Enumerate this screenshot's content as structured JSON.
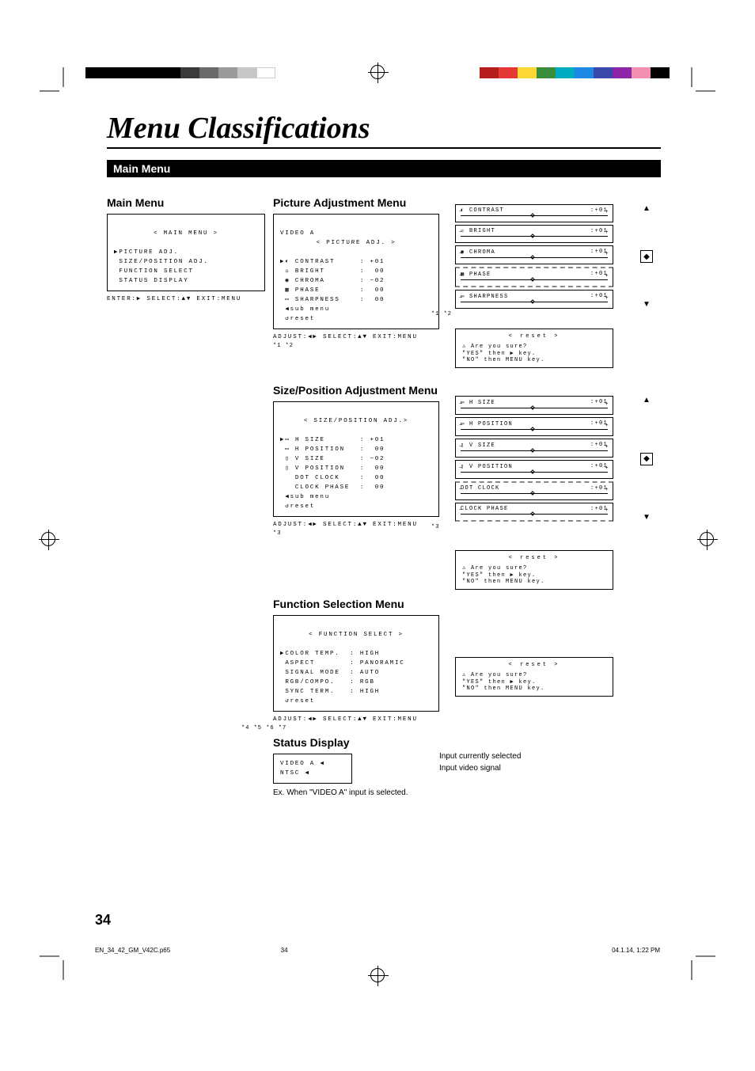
{
  "title": "Menu Classifications",
  "section": "Main Menu",
  "page_number": "34",
  "footer": {
    "file": "EN_34_42_GM_V42C.p65",
    "page": "34",
    "date": "04.1.14, 1:22 PM"
  },
  "color_bars_left": [
    "#000",
    "#000",
    "#000",
    "#000",
    "#000",
    "#3a3a3a",
    "#6a6a6a",
    "#9a9a9a",
    "#c7c7c7",
    "#fff"
  ],
  "color_bars_right": [
    "#b71c1c",
    "#e53935",
    "#fdd835",
    "#388e3c",
    "#00acc1",
    "#1e88e5",
    "#3949ab",
    "#8e24aa",
    "#f48fb1",
    "#000"
  ],
  "main_menu": {
    "heading": "Main Menu",
    "osd_title": "< MAIN MENU >",
    "items": [
      "PICTURE ADJ.",
      "SIZE/POSITION ADJ.",
      "FUNCTION SELECT",
      "STATUS DISPLAY"
    ],
    "hint": "ENTER:▶  SELECT:▲▼  EXIT:MENU"
  },
  "picture": {
    "heading": "Picture Adjustment Menu",
    "osd_source": "VIDEO A",
    "osd_title": "< PICTURE ADJ. >",
    "rows": [
      {
        "label": "CONTRAST",
        "val": "+01"
      },
      {
        "label": "BRIGHT",
        "val": "00"
      },
      {
        "label": "CHROMA",
        "val": "−02"
      },
      {
        "label": "PHASE",
        "val": "00"
      },
      {
        "label": "SHARPNESS",
        "val": "00"
      }
    ],
    "sub": "sub menu",
    "reset": "reset",
    "hint": "ADJUST:◀▶ SELECT:▲▼  EXIT:MENU",
    "stars": "*1 *2",
    "sliders": [
      {
        "name": "CONTRAST",
        "val": ":+01"
      },
      {
        "name": "BRIGHT",
        "val": ":+01"
      },
      {
        "name": "CHROMA",
        "val": ":+01"
      },
      {
        "name": "PHASE",
        "val": ":+01"
      },
      {
        "name": "SHARPNESS",
        "val": ":+01"
      }
    ],
    "slider_stars": "*1 *2"
  },
  "size": {
    "heading": "Size/Position Adjustment Menu",
    "osd_title": "< SIZE/POSITION ADJ.>",
    "rows": [
      {
        "label": "H SIZE",
        "val": "+01"
      },
      {
        "label": "H POSITION",
        "val": "00"
      },
      {
        "label": "V SIZE",
        "val": "−02"
      },
      {
        "label": "V POSITION",
        "val": "00"
      },
      {
        "label": "DOT CLOCK",
        "val": "00"
      },
      {
        "label": "CLOCK PHASE",
        "val": "00"
      }
    ],
    "sub": "sub menu",
    "reset": "reset",
    "hint": "ADJUST:◀▶ SELECT:▲▼  EXIT:MENU",
    "stars": "*3",
    "sliders": [
      {
        "name": "H SIZE",
        "val": ":+01"
      },
      {
        "name": "H POSITION",
        "val": ":+01"
      },
      {
        "name": "V SIZE",
        "val": ":+01"
      },
      {
        "name": "V POSITION",
        "val": ":+01"
      },
      {
        "name": "DOT CLOCK",
        "val": ":+01"
      },
      {
        "name": "CLOCK PHASE",
        "val": ":+01"
      }
    ],
    "slider_stars": "*3"
  },
  "func": {
    "heading": "Function Selection Menu",
    "osd_title": "< FUNCTION SELECT >",
    "rows": [
      {
        "label": "COLOR TEMP.",
        "val": "HIGH"
      },
      {
        "label": "ASPECT",
        "val": "PANORAMIC"
      },
      {
        "label": "SIGNAL MODE",
        "val": "AUTO"
      },
      {
        "label": "RGB/COMPO.",
        "val": "RGB"
      },
      {
        "label": "SYNC TERM.",
        "val": "HIGH"
      }
    ],
    "reset": "reset",
    "hint": "ADJUST:◀▶ SELECT:▲▼  EXIT:MENU",
    "stars": "*4 *5  *6 *7"
  },
  "reset": {
    "title": "< reset >",
    "l1": "⚠ Are you sure?",
    "l2": "\"YES\" then   ▶   key.",
    "l3": "\"NO\"  then  MENU  key."
  },
  "status": {
    "heading": "Status Display",
    "line1": "VIDEO A",
    "line2": "NTSC",
    "note": "Ex. When \"VIDEO A\" input is selected.",
    "label1": "Input currently selected",
    "label2": "Input video signal"
  }
}
